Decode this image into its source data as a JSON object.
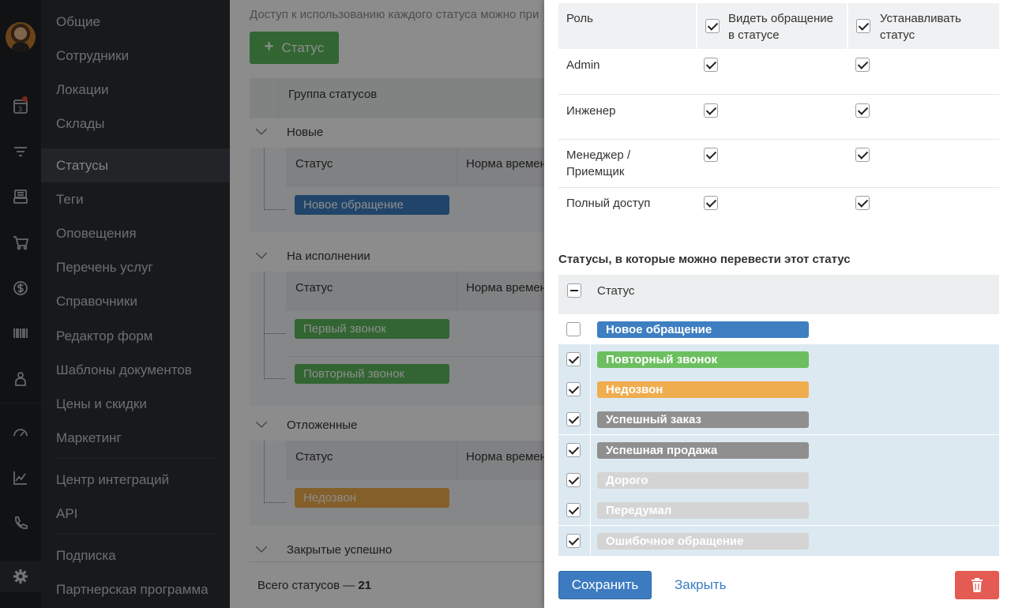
{
  "menu": {
    "items": [
      "Общие",
      "Сотрудники",
      "Локации",
      "Склады",
      "Статусы",
      "Теги",
      "Оповещения",
      "Перечень услуг",
      "Справочники",
      "Редактор форм",
      "Шаблоны документов",
      "Цены и скидки",
      "Маркетинг",
      "Центр интеграций",
      "API",
      "Подписка",
      "Партнерская программа"
    ],
    "active": "Статусы"
  },
  "rail": {
    "badge": "3"
  },
  "main": {
    "hint": "Доступ к использованию каждого статуса можно при",
    "add_button": "Статус",
    "table_header": "Группа статусов",
    "col_status": "Статус",
    "col_norm": "Норма времени",
    "groups": [
      {
        "name": "Новые",
        "statuses": [
          {
            "label": "Новое обращение",
            "color": "#3d7fc1"
          }
        ]
      },
      {
        "name": "На исполнении",
        "statuses": [
          {
            "label": "Первый звонок",
            "color": "#5cb85c"
          },
          {
            "label": "Повторный звонок",
            "color": "#5cb85c"
          }
        ]
      },
      {
        "name": "Отложенные",
        "statuses": [
          {
            "label": "Недозвон",
            "color": "#f0ad4e"
          }
        ]
      },
      {
        "name": "Закрытые успешно",
        "statuses": []
      }
    ],
    "total_label": "Всего статусов — ",
    "total_value": "21"
  },
  "panel": {
    "roles_header": {
      "role": "Роль",
      "see": "Видеть обращение в статусе",
      "set": "Устанавливать статус"
    },
    "roles": [
      {
        "name": "Admin",
        "see": true,
        "set": true
      },
      {
        "name": "Инженер",
        "see": true,
        "set": true
      },
      {
        "name": "Менеджер / Приемщик",
        "see": true,
        "set": true
      },
      {
        "name": "Полный доступ",
        "see": true,
        "set": true
      }
    ],
    "transitions_title": "Статусы, в которые можно перевести этот статус",
    "transitions_header": "Статус",
    "transitions": [
      {
        "label": "Новое обращение",
        "color": "#3d7fc1",
        "checked": false
      },
      {
        "label": "Повторный звонок",
        "color": "#6cbf5f",
        "checked": true
      },
      {
        "label": "Недозвон",
        "color": "#f0ad4e",
        "checked": true
      },
      {
        "label": "Успешный заказ",
        "color": "#8f8f8f",
        "checked": true
      },
      {
        "label": "Успешная продажа",
        "color": "#8f8f8f",
        "checked": true
      },
      {
        "label": "Дорого",
        "color": "#d4d4d4",
        "checked": true
      },
      {
        "label": "Передумал",
        "color": "#d4d4d4",
        "checked": true
      },
      {
        "label": "Ошибочное обращение",
        "color": "#d4d4d4",
        "checked": true
      }
    ],
    "save_button": "Сохранить",
    "close_button": "Закрыть"
  }
}
